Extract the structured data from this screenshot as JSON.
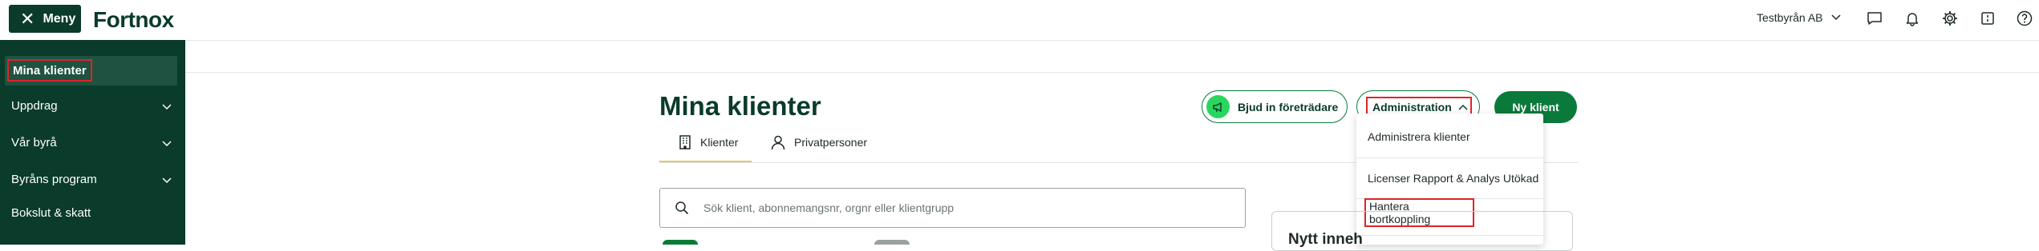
{
  "topbar": {
    "menu_label": "Meny",
    "logo_text": "Fortnox",
    "company_name": "Testbyrån AB",
    "icons": [
      "chat-icon",
      "bell-icon",
      "gear-icon",
      "apps-icon",
      "help-icon"
    ]
  },
  "sidebar": {
    "items": [
      {
        "label": "Mina klienter",
        "active": true
      },
      {
        "label": "Uppdrag",
        "expandable": true
      },
      {
        "label": "Vår byrå",
        "expandable": true
      },
      {
        "label": "Byråns program",
        "expandable": true
      },
      {
        "label": "Bokslut & skatt",
        "expandable": false
      }
    ]
  },
  "main": {
    "title": "Mina klienter",
    "tabs": [
      {
        "label": "Klienter",
        "active": true
      },
      {
        "label": "Privatpersoner",
        "active": false
      }
    ],
    "search": {
      "placeholder": "Sök klient, abonnemangsnr, orgnr eller klientgrupp",
      "value": ""
    },
    "actions": {
      "invite_label": "Bjud in företrädare",
      "admin_label": "Administration",
      "new_client_label": "Ny klient"
    },
    "admin_menu": [
      "Administrera klienter",
      "Licenser Rapport & Analys Utökad",
      "Hantera bortkoppling"
    ],
    "news_title": "Nytt inneh"
  },
  "colors": {
    "brand_dark": "#0a3b2b",
    "brand_green": "#0a7a3a",
    "accent_underline": "#e8c36a",
    "highlight_red": "#e0232a"
  }
}
